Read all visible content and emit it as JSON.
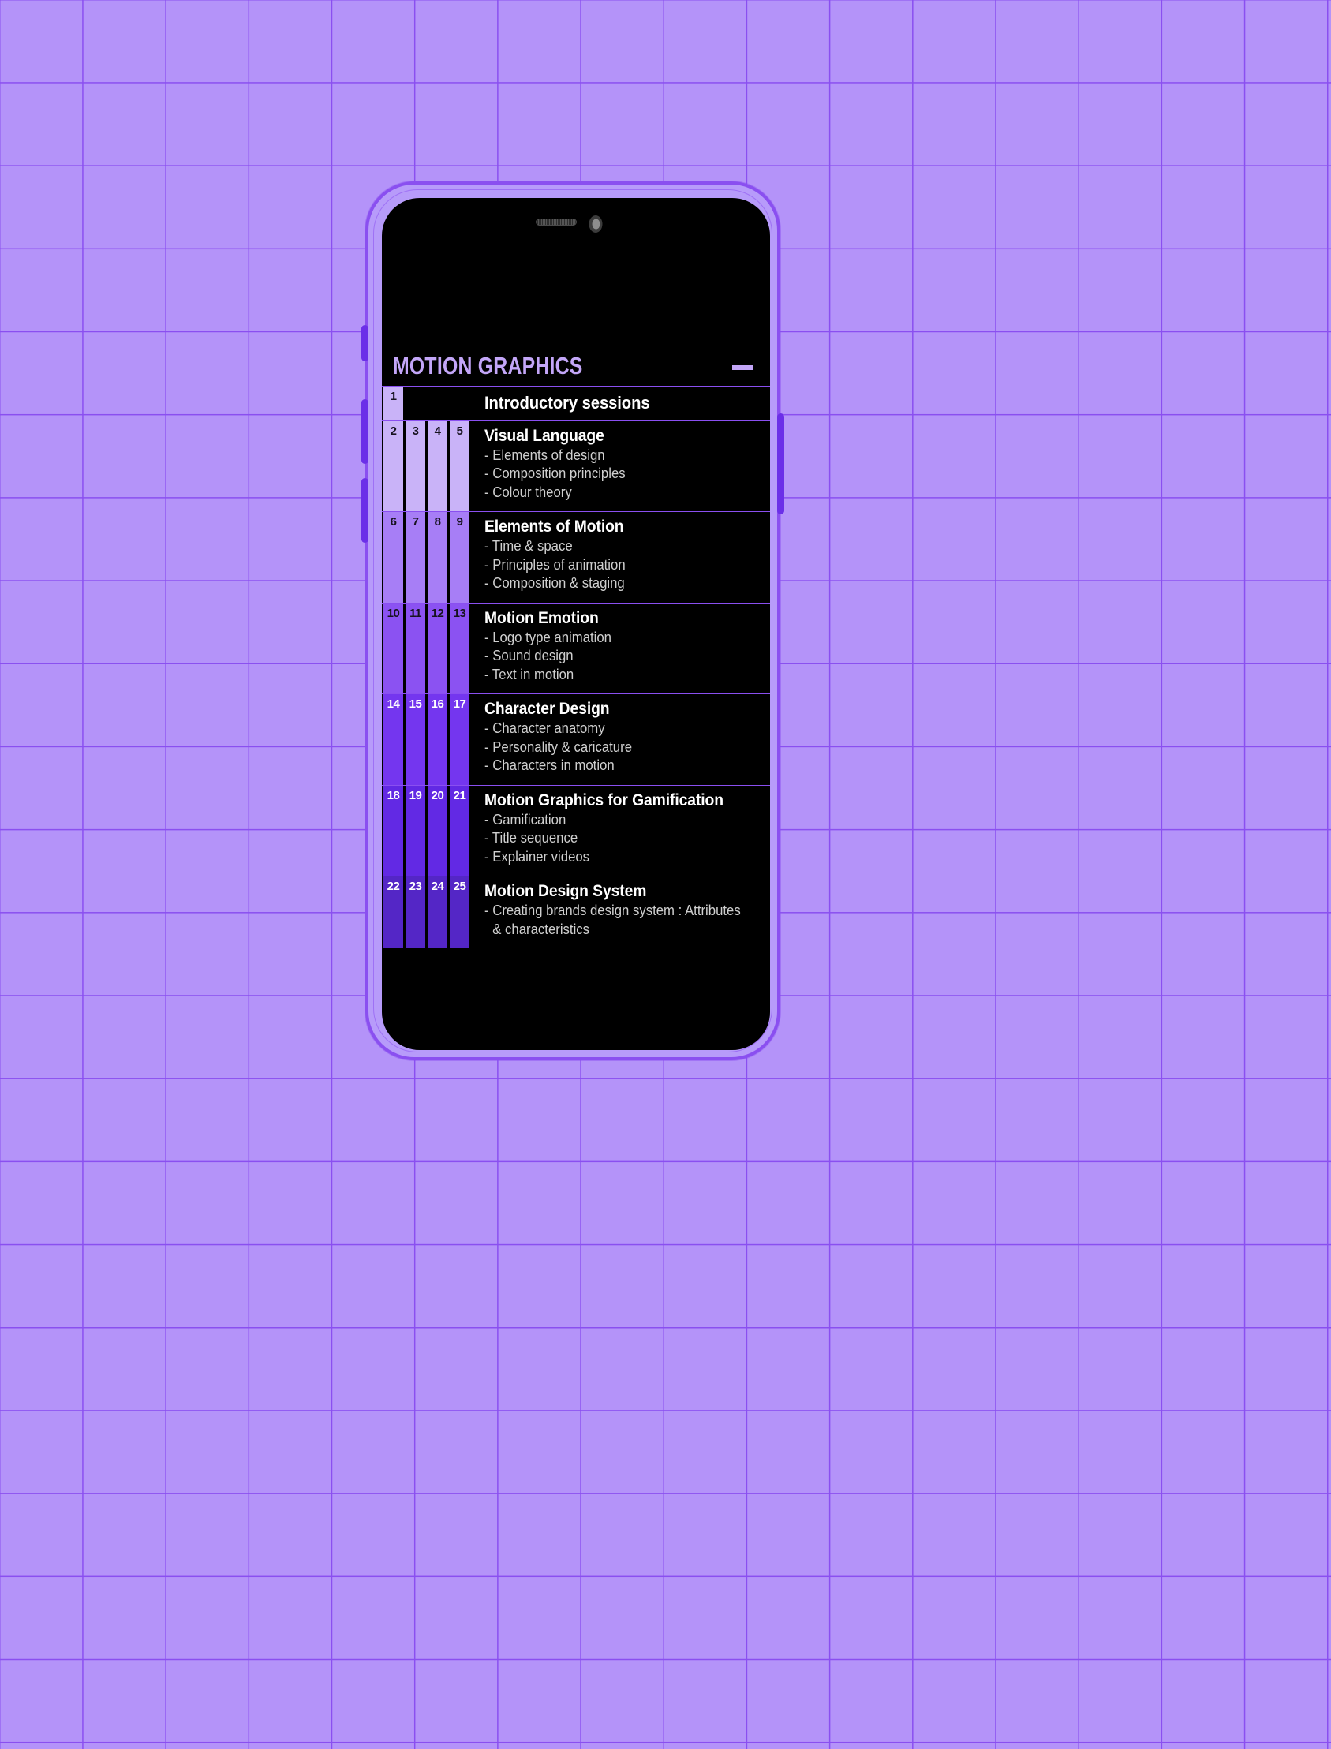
{
  "app": {
    "title": "MOTION GRAPHICS",
    "collapse_label": "—",
    "collapse_icon": "minus-icon"
  },
  "device": {
    "frame_color": "#b79bfa",
    "accent_color": "#8a4ff0",
    "screen_color": "#000000",
    "speaker_icon": "speaker-grille-icon",
    "camera_icon": "front-camera-icon",
    "buttons": [
      "mute-switch",
      "volume-up",
      "volume-down",
      "power"
    ]
  },
  "background": {
    "color": "#b493f9",
    "grid_line_color": "#8a4ff0",
    "grid_size_px": 105
  },
  "schedule": {
    "rows": [
      {
        "numbers": [
          "1"
        ],
        "number_bg": "#c9b3f8",
        "number_text_color": "#17121f",
        "title": "Introductory sessions",
        "items": []
      },
      {
        "numbers": [
          "2",
          "3",
          "4",
          "5"
        ],
        "number_bg": "#c9b3f8",
        "number_text_color": "#17121f",
        "title": "Visual Language",
        "items": [
          "- Elements of design",
          "- Composition principles",
          "- Colour theory"
        ]
      },
      {
        "numbers": [
          "6",
          "7",
          "8",
          "9"
        ],
        "number_bg": "#a77ef6",
        "number_text_color": "#17121f",
        "title": "Elements of Motion",
        "items": [
          "- Time & space",
          "- Principles of animation",
          "- Composition & staging"
        ]
      },
      {
        "numbers": [
          "10",
          "11",
          "12",
          "13"
        ],
        "number_bg": "#8b52f2",
        "number_text_color": "#17121f",
        "title": "Motion Emotion",
        "items": [
          "- Logo type animation",
          "- Sound design",
          "- Text in motion"
        ]
      },
      {
        "numbers": [
          "14",
          "15",
          "16",
          "17"
        ],
        "number_bg": "#7436ef",
        "number_text_color": "#ffffff",
        "title": "Character Design",
        "items": [
          "- Character anatomy",
          "- Personality & caricature",
          "- Characters in motion"
        ]
      },
      {
        "numbers": [
          "18",
          "19",
          "20",
          "21"
        ],
        "number_bg": "#6229e4",
        "number_text_color": "#ffffff",
        "title": "Motion Graphics for Gamification",
        "items": [
          "- Gamification",
          "- Title sequence",
          "- Explainer videos"
        ]
      },
      {
        "numbers": [
          "22",
          "23",
          "24",
          "25"
        ],
        "number_bg": "#5426c6",
        "number_text_color": "#ffffff",
        "title": "Motion Design System",
        "items": [
          "- Creating brands design system : Attributes",
          "& characteristics"
        ]
      }
    ]
  }
}
